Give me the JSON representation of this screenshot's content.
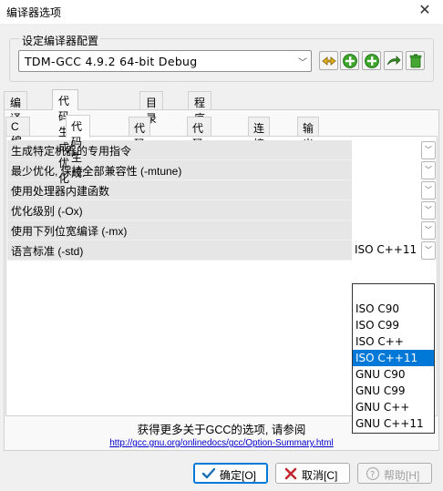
{
  "window": {
    "title": "编译器选项",
    "close_glyph": "✕"
  },
  "compiler_set": {
    "group_label": "设定编译器配置",
    "selected": "TDM-GCC 4.9.2 64-bit Debug",
    "toolbar_icons": [
      "rename-profile-icon",
      "add-profile-icon",
      "add-profile-icon-2",
      "find-compiler-icon",
      "delete-profile-icon"
    ]
  },
  "main_tabs": [
    "编译器",
    "代码生成/优化",
    "目录",
    "程序"
  ],
  "sub_tabs": [
    "C 编译器:",
    "代码生成:",
    "代码警告",
    "代码性能:",
    "连接器",
    "输出"
  ],
  "options": [
    {
      "label": "生成特定机器的专用指令",
      "value": ""
    },
    {
      "label": "最少优化, 保持全部兼容性 (-mtune)",
      "value": ""
    },
    {
      "label": "使用处理器内建函数",
      "value": ""
    },
    {
      "label": "优化级别 (-Ox)",
      "value": ""
    },
    {
      "label": "使用下列位宽编译 (-mx)",
      "value": ""
    },
    {
      "label": "语言标准 (-std)",
      "value": "ISO C++11"
    }
  ],
  "std_dropdown": {
    "options": [
      "",
      "ISO C90",
      "ISO C99",
      "ISO C++",
      "ISO C++11",
      "GNU C90",
      "GNU C99",
      "GNU C++",
      "GNU C++11"
    ],
    "selected": "ISO C++11",
    "highlight_color": "#0078d7"
  },
  "footer": {
    "info_text": "获得更多关于GCC的选项, 请参阅",
    "link_text": "http://gcc.gnu.org/onlinedocs/gcc/Option-Summary.html"
  },
  "buttons": {
    "ok": "确定[O]",
    "cancel": "取消[C]",
    "help": "帮助[H]"
  }
}
